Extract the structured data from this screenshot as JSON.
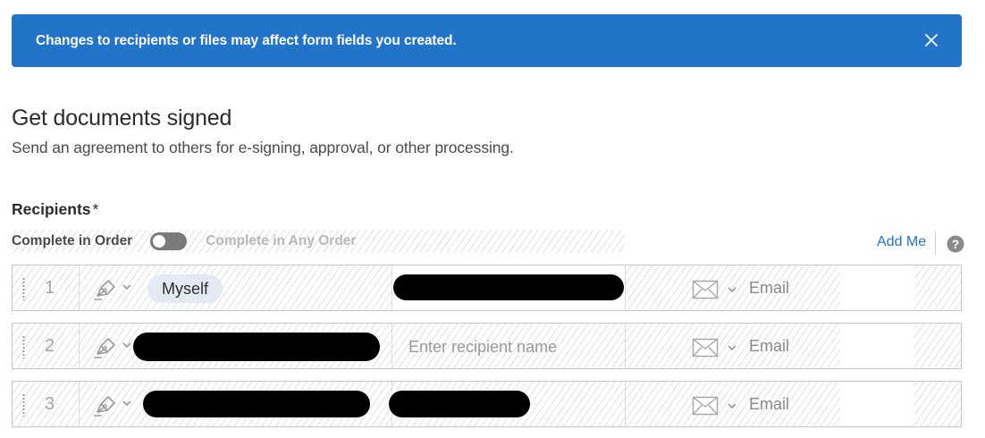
{
  "banner": {
    "message": "Changes to recipients or files may affect form fields you created.",
    "close_icon": "close-icon"
  },
  "header": {
    "title": "Get documents signed",
    "subtitle": "Send an agreement to others for e-signing, approval, or other processing."
  },
  "recipients": {
    "label": "Recipients",
    "required_mark": "*",
    "order_left_label": "Complete in Order",
    "order_right_label": "Complete in Any Order",
    "order_toggle_on": false,
    "add_me_label": "Add Me",
    "help_icon": "help-icon",
    "rows": [
      {
        "number": "1",
        "role_icon": "signer-pen-icon",
        "chip_label": "Myself",
        "name_placeholder": "",
        "auth_icon": "email-icon",
        "auth_label": "Email"
      },
      {
        "number": "2",
        "role_icon": "signer-pen-icon",
        "chip_label": "",
        "name_placeholder": "Enter recipient name",
        "auth_icon": "email-icon",
        "auth_label": "Email"
      },
      {
        "number": "3",
        "role_icon": "signer-pen-icon",
        "chip_label": "",
        "name_placeholder": "",
        "auth_icon": "email-icon",
        "auth_label": "Email"
      }
    ]
  },
  "colors": {
    "banner_background": "#2274c9",
    "link": "#2274c9",
    "chip_background": "#e4eaf3",
    "toggle_off": "#7a7a7a"
  }
}
